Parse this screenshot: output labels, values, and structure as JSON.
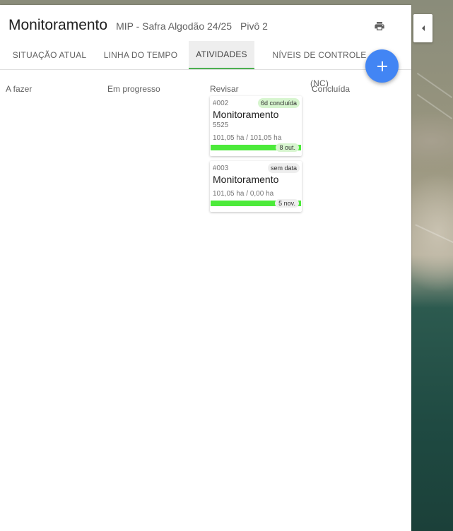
{
  "header": {
    "title": "Monitoramento",
    "subtitle": "MIP - Safra Algodão 24/25",
    "pivot": "Pivô 2"
  },
  "tabs": [
    {
      "label": "SITUAÇÃO ATUAL",
      "active": false
    },
    {
      "label": "LINHA DO TEMPO",
      "active": false
    },
    {
      "label": "ATIVIDADES",
      "active": true
    },
    {
      "label": "NÍVEIS DE CONTROLE (NC)",
      "active": false
    }
  ],
  "columns": [
    "A fazer",
    "Em progresso",
    "Revisar",
    "Concluída"
  ],
  "cards": [
    {
      "id": "#002",
      "badge": "6d concluída",
      "badge_color": "#d7f5cf",
      "title": "Monitoramento",
      "code": "5525",
      "area": "101,05 ha / 101,05 ha",
      "progress": 1.0,
      "date": "8 out.",
      "date_color": "#d7f5cf"
    },
    {
      "id": "#003",
      "badge": "sem data",
      "badge_color": "#eeeeee",
      "title": "Monitoramento",
      "area": "101,05 ha / 0,00 ha",
      "progress": 1.0,
      "date": "5 nov.",
      "date_color": "#eeeeee"
    }
  ],
  "colors": {
    "accent": "#4285f4",
    "tab_indicator": "#4caf50",
    "progress": "#4cea3a"
  },
  "icons": {
    "print": "printer-icon",
    "add": "plus-icon",
    "collapse": "chevron-left-icon"
  }
}
